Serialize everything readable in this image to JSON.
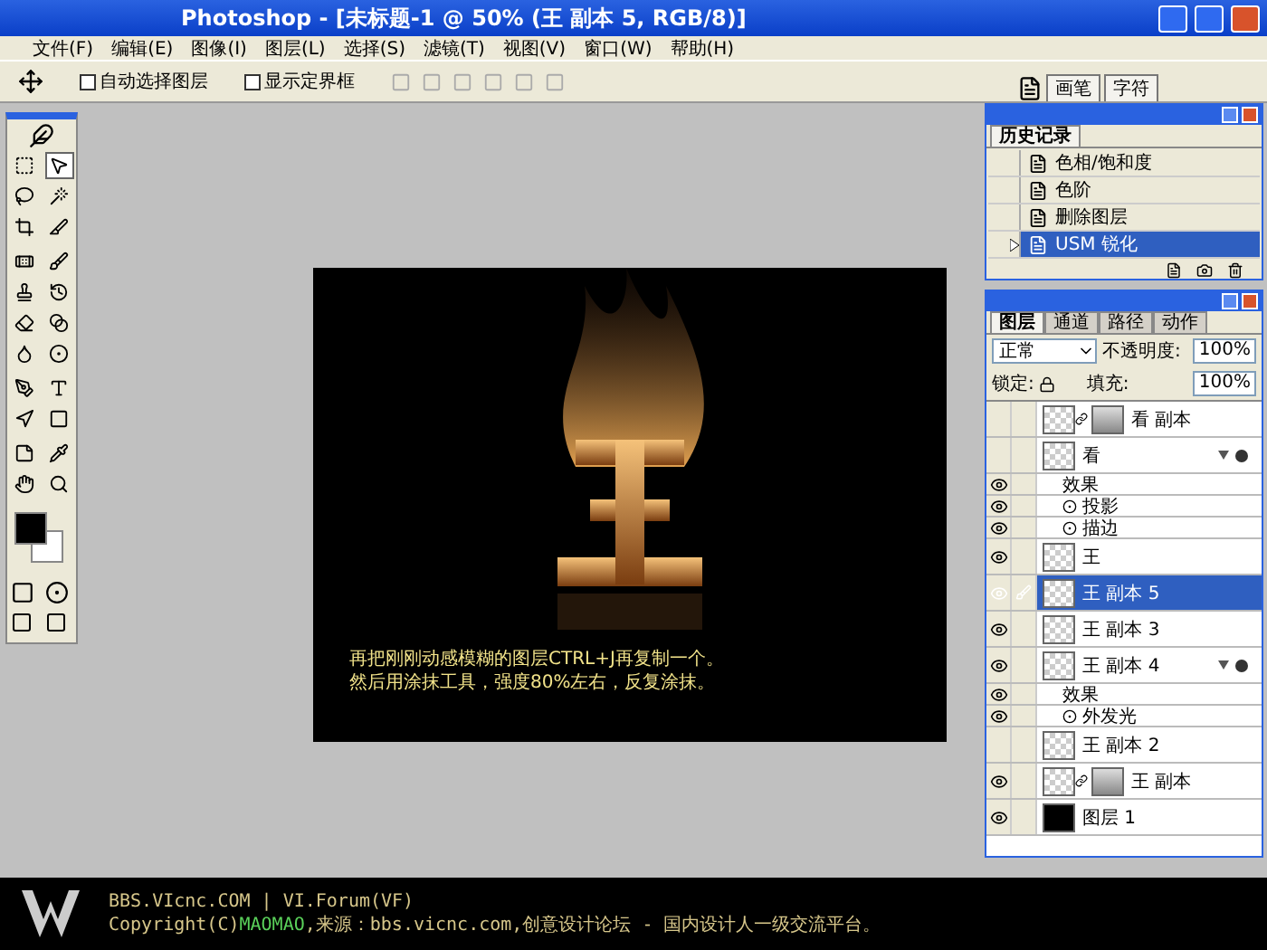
{
  "window": {
    "title": "Photoshop - [未标题-1 @ 50% (王 副本 5, RGB/8)]"
  },
  "menu": [
    "文件(F)",
    "编辑(E)",
    "图像(I)",
    "图层(L)",
    "选择(S)",
    "滤镜(T)",
    "视图(V)",
    "窗口(W)",
    "帮助(H)"
  ],
  "options_bar": {
    "checkboxes": [
      {
        "label": "自动选择图层",
        "checked": false
      },
      {
        "label": "显示定界框",
        "checked": false
      }
    ]
  },
  "palette_well": {
    "tabs": [
      "画笔",
      "字符"
    ]
  },
  "tools": [
    {
      "selected": false
    },
    {
      "selected": true
    },
    {
      "selected": false
    },
    {
      "selected": false
    },
    {
      "selected": false
    },
    {
      "selected": false
    },
    {
      "selected": false
    },
    {
      "selected": false
    },
    {
      "selected": false
    },
    {
      "selected": false
    },
    {
      "selected": false
    },
    {
      "selected": false
    },
    {
      "selected": false
    },
    {
      "selected": false
    },
    {
      "selected": false
    },
    {
      "selected": false
    },
    {
      "selected": false
    },
    {
      "selected": false
    },
    {
      "selected": false
    },
    {
      "selected": false
    },
    {
      "selected": false
    },
    {
      "selected": false
    }
  ],
  "canvas": {
    "caption": [
      "再把刚刚动感模糊的图层CTRL+J再复制一个。",
      "然后用涂抹工具，强度80%左右，反复涂抹。"
    ]
  },
  "history": {
    "tab": "历史记录",
    "items": [
      {
        "label": "色相/饱和度",
        "selected": false
      },
      {
        "label": "色阶",
        "selected": false
      },
      {
        "label": "删除图层",
        "selected": false
      },
      {
        "label": "USM 锐化",
        "selected": true
      }
    ]
  },
  "layers_panel": {
    "tabs": [
      {
        "label": "图层",
        "selected": true
      },
      {
        "label": "通道",
        "selected": false
      },
      {
        "label": "路径",
        "selected": false
      },
      {
        "label": "动作",
        "selected": false
      }
    ],
    "blend_mode": "正常",
    "opacity_label": "不透明度:",
    "opacity": "100%",
    "lock_label": "锁定:",
    "fill_label": "填充:",
    "fill": "100%",
    "layers": [
      {
        "kind": "layer",
        "name": "看 副本",
        "visible": false,
        "selected": false,
        "mask": true,
        "effects": false,
        "dark_thumbnail": false
      },
      {
        "kind": "layer",
        "name": "看",
        "visible": false,
        "selected": false,
        "mask": false,
        "effects": true,
        "dark_thumbnail": false
      },
      {
        "kind": "effects_header",
        "name": "效果",
        "visible": true
      },
      {
        "kind": "effect",
        "name": "投影",
        "visible": true
      },
      {
        "kind": "effect",
        "name": "描边",
        "visible": true
      },
      {
        "kind": "layer",
        "name": "王",
        "visible": true,
        "selected": false,
        "mask": false,
        "effects": false,
        "dark_thumbnail": false
      },
      {
        "kind": "layer",
        "name": "王 副本 5",
        "visible": true,
        "selected": true,
        "mask": false,
        "effects": false,
        "dark_thumbnail": false
      },
      {
        "kind": "layer",
        "name": "王 副本 3",
        "visible": true,
        "selected": false,
        "mask": false,
        "effects": false,
        "dark_thumbnail": false
      },
      {
        "kind": "layer",
        "name": "王 副本 4",
        "visible": true,
        "selected": false,
        "mask": false,
        "effects": true,
        "dark_thumbnail": false
      },
      {
        "kind": "effects_header",
        "name": "效果",
        "visible": true
      },
      {
        "kind": "effect",
        "name": "外发光",
        "visible": true
      },
      {
        "kind": "layer",
        "name": "王 副本 2",
        "visible": false,
        "selected": false,
        "mask": false,
        "effects": false,
        "dark_thumbnail": false
      },
      {
        "kind": "layer",
        "name": "王 副本",
        "visible": true,
        "selected": false,
        "mask": true,
        "effects": false,
        "dark_thumbnail": false
      },
      {
        "kind": "layer",
        "name": "图层 1",
        "visible": true,
        "selected": false,
        "mask": false,
        "effects": false,
        "dark_thumbnail": true
      }
    ]
  },
  "footer": {
    "line1": "BBS.VIcnc.COM | VI.Forum(VF)",
    "copyright_prefix": "Copyright(C)",
    "copyright_name": "MAOMAO",
    "copyright_rest": ",来源：bbs.vicnc.com,创意设计论坛 - 国内设计人一级交流平台。"
  }
}
